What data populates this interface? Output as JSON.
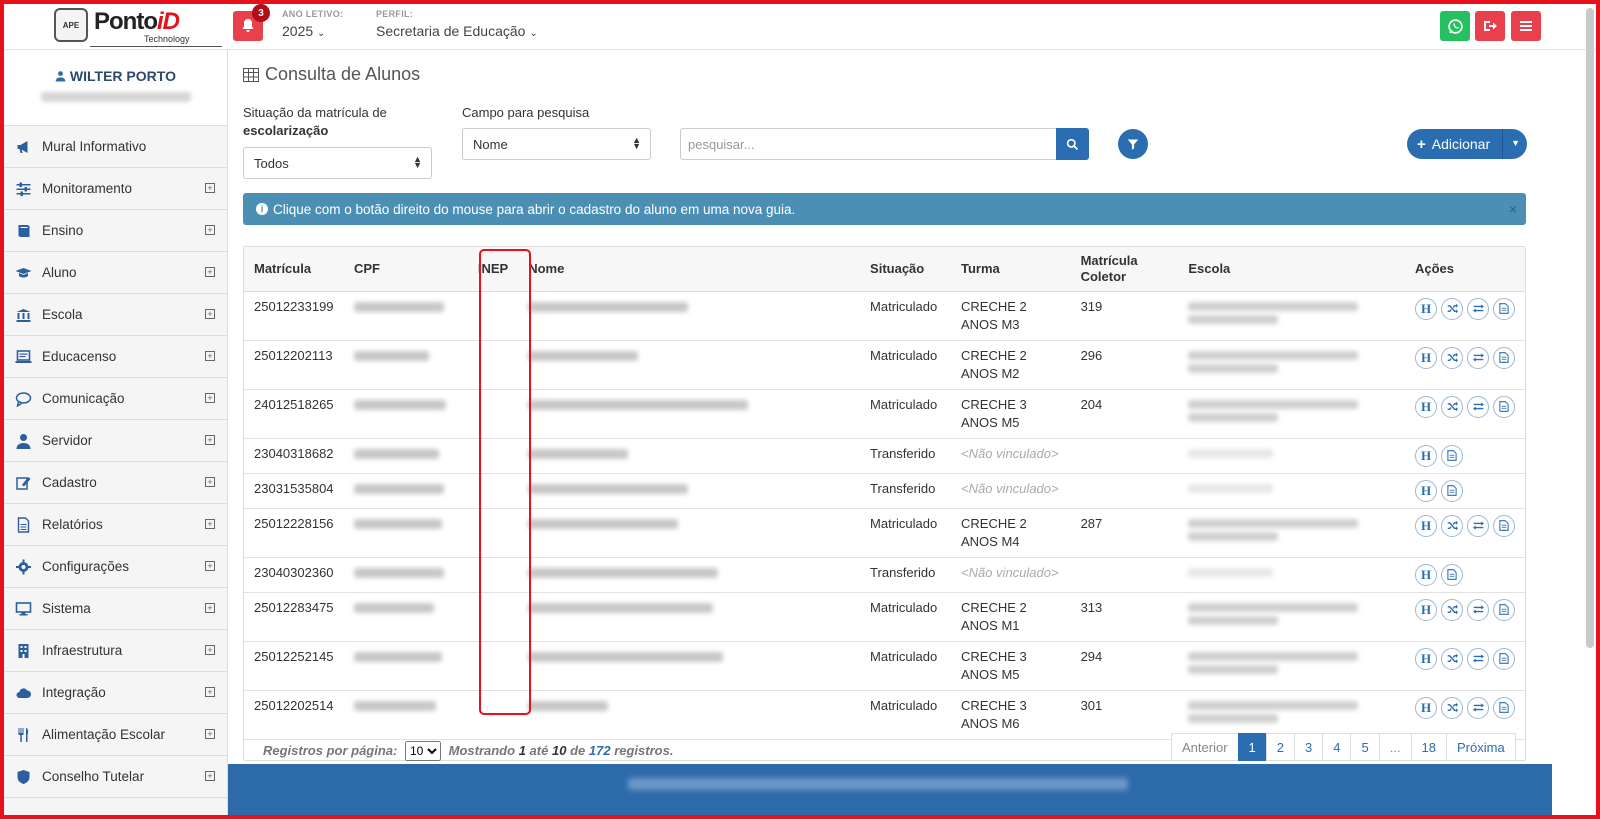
{
  "header": {
    "logo_brand": "Ponto",
    "logo_brand_id": "iD",
    "logo_tech": "Technology",
    "logo_badge": "APE",
    "notifications_count": "3",
    "ano_letivo_label": "ANO LETIVO:",
    "ano_letivo_value": "2025",
    "perfil_label": "PERFIL:",
    "perfil_value": "Secretaria de Educação",
    "colors": {
      "whatsapp": "#25c160",
      "logout": "#e8404d",
      "menu": "#e8404d"
    }
  },
  "sidebar": {
    "user_name": "WILTER PORTO",
    "items": [
      {
        "label": "Mural Informativo",
        "icon": "megaphone-icon",
        "expandable": false
      },
      {
        "label": "Monitoramento",
        "icon": "sliders-icon",
        "expandable": true
      },
      {
        "label": "Ensino",
        "icon": "book-icon",
        "expandable": true
      },
      {
        "label": "Aluno",
        "icon": "graduation-cap-icon",
        "expandable": true
      },
      {
        "label": "Escola",
        "icon": "institution-icon",
        "expandable": true
      },
      {
        "label": " Educacenso",
        "icon": "laptop-icon",
        "expandable": true
      },
      {
        "label": "Comunicação",
        "icon": "chat-bubble-icon",
        "expandable": true
      },
      {
        "label": "Servidor",
        "icon": "user-icon",
        "expandable": true
      },
      {
        "label": "Cadastro",
        "icon": "edit-icon",
        "expandable": true
      },
      {
        "label": "Relatórios",
        "icon": "document-icon",
        "expandable": true
      },
      {
        "label": "Configurações",
        "icon": "gear-icon",
        "expandable": true
      },
      {
        "label": "Sistema",
        "icon": "monitor-icon",
        "expandable": true
      },
      {
        "label": "Infraestrutura",
        "icon": "building-icon",
        "expandable": true
      },
      {
        "label": "Integração",
        "icon": "cloud-icon",
        "expandable": true
      },
      {
        "label": "Alimentação Escolar",
        "icon": "cutlery-icon",
        "expandable": true
      },
      {
        "label": "Conselho Tutelar",
        "icon": "shield-icon",
        "expandable": true
      }
    ]
  },
  "main": {
    "title": "Consulta de Alunos",
    "situacao_label_1": "Situação da matrícula de",
    "situacao_label_2": "escolarização",
    "situacao_value": "Todos",
    "campo_label": "Campo para pesquisa",
    "campo_value": "Nome",
    "search_placeholder": "pesquisar...",
    "add_label": "Adicionar",
    "alert_text": "Clique com o botão direito do mouse para abrir o cadastro do aluno em uma nova guia.",
    "alert_close": "×"
  },
  "table": {
    "columns": [
      "Matrícula",
      "CPF",
      "INEP",
      "Nome",
      "Situação",
      "Turma",
      "Matrícula Coletor",
      "Escola",
      "Ações"
    ],
    "rows": [
      {
        "matricula": "25012233199",
        "situacao": "Matriculado",
        "turma": "CRECHE 2 ANOS M3",
        "coletor": "319",
        "actions": 4
      },
      {
        "matricula": "25012202113",
        "situacao": "Matriculado",
        "turma": "CRECHE 2 ANOS M2",
        "coletor": "296",
        "actions": 4
      },
      {
        "matricula": "24012518265",
        "situacao": "Matriculado",
        "turma": "CRECHE 3 ANOS M5",
        "coletor": "204",
        "actions": 4
      },
      {
        "matricula": "23040318682",
        "situacao": "Transferido",
        "turma": "<Não vinculado>",
        "coletor": "",
        "actions": 2
      },
      {
        "matricula": "23031535804",
        "situacao": "Transferido",
        "turma": "<Não vinculado>",
        "coletor": "",
        "actions": 2
      },
      {
        "matricula": "25012228156",
        "situacao": "Matriculado",
        "turma": "CRECHE 2 ANOS M4",
        "coletor": "287",
        "actions": 4
      },
      {
        "matricula": "23040302360",
        "situacao": "Transferido",
        "turma": "<Não vinculado>",
        "coletor": "",
        "actions": 2
      },
      {
        "matricula": "25012283475",
        "situacao": "Matriculado",
        "turma": "CRECHE 2 ANOS M1",
        "coletor": "313",
        "actions": 4
      },
      {
        "matricula": "25012252145",
        "situacao": "Matriculado",
        "turma": "CRECHE 3 ANOS M5",
        "coletor": "294",
        "actions": 4
      },
      {
        "matricula": "25012202514",
        "situacao": "Matriculado",
        "turma": "CRECHE 3 ANOS M6",
        "coletor": "301",
        "actions": 4
      }
    ]
  },
  "pagination": {
    "per_page_label": "Registros por página:",
    "per_page_value": "10",
    "mostrando": "Mostrando",
    "from": "1",
    "ate": "até",
    "to": "10",
    "de": "de",
    "total": "172",
    "registros": "registros.",
    "prev": "Anterior",
    "pages": [
      "1",
      "2",
      "3",
      "4",
      "5",
      "...",
      "18"
    ],
    "next": "Próxima"
  }
}
